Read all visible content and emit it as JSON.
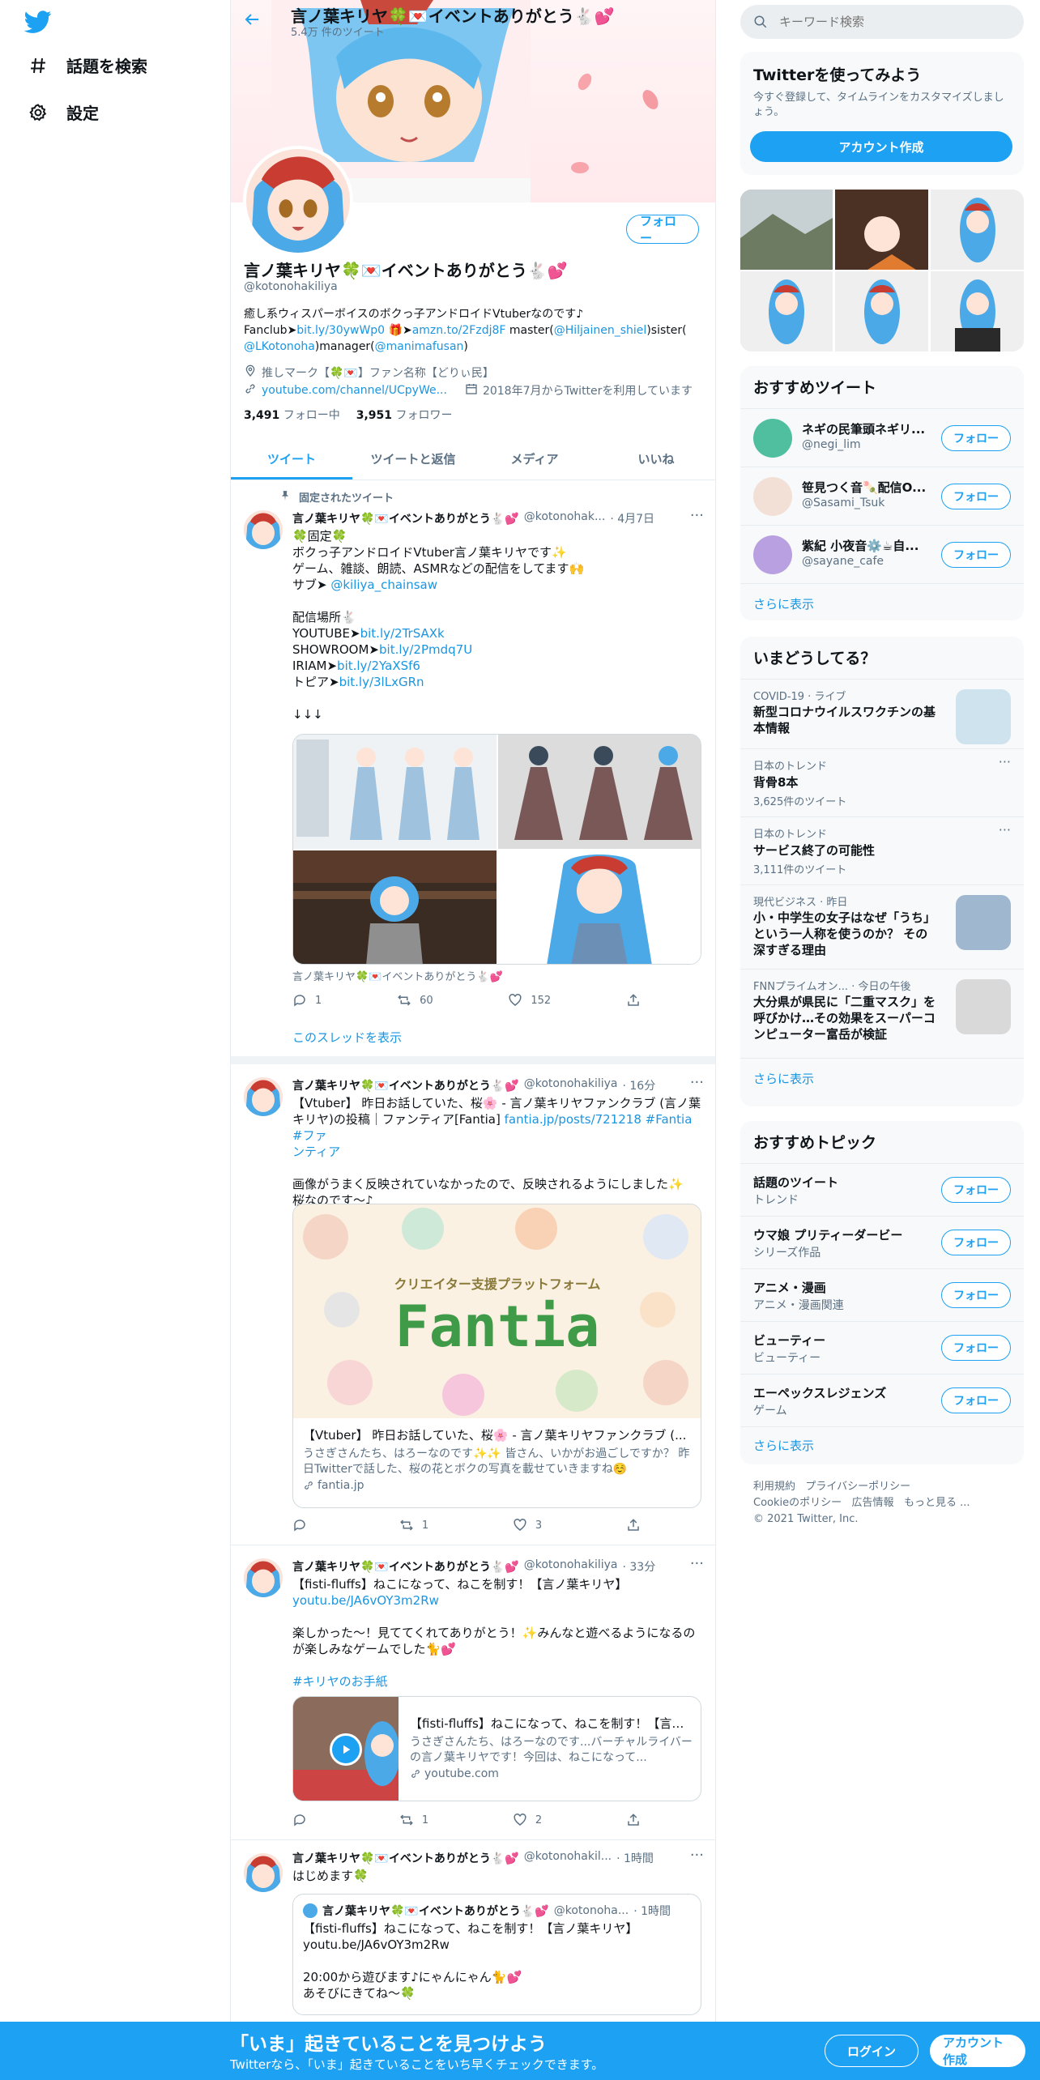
{
  "nav": {
    "explore_label": "話題を検索",
    "settings_label": "設定"
  },
  "header": {
    "title": "言ノ葉キリヤ🍀💌イベントありがとう🐇💕",
    "tweet_count": "5.4万 件のツイート"
  },
  "profile": {
    "name": "言ノ葉キリヤ🍀💌イベントありがとう🐇💕",
    "handle": "@kotonohakiliya",
    "follow_label": "フォロー",
    "bio_line1": "癒し系ウィスパーボイスのボクっ子アンドロイドVtuberなのです♪",
    "bio_line2_a": "Fanclub➤",
    "bio_line2_b": "bit.ly/30ywWp0",
    "bio_line2_c": " 🎁➤",
    "bio_line2_d": "amzn.to/2Fzdj8F",
    "bio_line2_e": " master(",
    "bio_line2_f": "@Hiljainen_shiel",
    "bio_line2_g": ")sister(",
    "bio_line3_a": "@LKotonoha",
    "bio_line3_b": ")manager(",
    "bio_line3_c": "@manimafusan",
    "bio_line3_d": ")",
    "location": "推しマーク【🍀💌】ファン名称【どりぃ民】",
    "url": "youtube.com/channel/UCpyWe...",
    "joined": "2018年7月からTwitterを利用しています",
    "following_count": "3,491",
    "following_label": "フォロー中",
    "followers_count": "3,951",
    "followers_label": "フォロワー"
  },
  "tabs": [
    "ツイート",
    "ツイートと返信",
    "メディア",
    "いいね"
  ],
  "tweets": [
    {
      "pinned_label": "固定されたツイート",
      "name": "言ノ葉キリヤ🍀💌イベントありがとう🐇💕",
      "handle": "@kotonohak...",
      "time": "· 4月7日",
      "lines": [
        "🍀固定🍀",
        "ボクっ子アンドロイドVtuber言ノ葉キリヤです✨",
        "ゲーム、雑談、朗読、ASMRなどの配信をしてます🙌"
      ],
      "sub_prefix": "サブ➤ ",
      "sub_link": "@kiliya_chainsaw",
      "place_header": "配信場所🐇",
      "yt_prefix": "YOUTUBE➤",
      "yt_link": "bit.ly/2TrSAXk",
      "sr_prefix": "SHOWROOM➤",
      "sr_link": "bit.ly/2Pmdq7U",
      "iriam_prefix": "IRIAM➤",
      "iriam_link": "bit.ly/2YaXSf6",
      "topia_prefix": "トピア➤",
      "topia_link": "bit.ly/3lLxGRn",
      "arrows": "↓↓↓",
      "media_caption": "言ノ葉キリヤ🍀💌イベントありがとう🐇💕",
      "reply_count": "1",
      "retweet_count": "60",
      "like_count": "152",
      "thread_link": "このスレッドを表示"
    },
    {
      "name": "言ノ葉キリヤ🍀💌イベントありがとう🐇💕",
      "handle": "@kotonohakiliya",
      "time": "· 16分",
      "line1": "【Vtuber】 昨日お話していた、桜🌸 - 言ノ葉キリヤファンクラブ (言ノ葉",
      "line2_a": "キリヤ)の投稿｜ファンティア[Fantia] ",
      "line2_b": "fantia.jp/posts/721218",
      "line2_c": " #Fantia",
      "line2_d": " #ファ",
      "line3": "ンティア",
      "line4": "画像がうまく反映されていなかったので、反映されるようにしました✨",
      "line5": "桜なのです～♪",
      "card_image_heading": "クリエイター支援プラットフォーム",
      "card_image_logo": "Fantia",
      "card_title": "【Vtuber】 昨日お話していた、桜🌸 - 言ノ葉キリヤファンクラブ (...",
      "card_desc": "うさぎさんたち、はろーなのです✨✨ 皆さん、いかがお過ごしですか？ 昨日Twitterで話した、桜の花とボクの写真を載せていきますね☺️",
      "card_domain": "fantia.jp",
      "reply_count": "",
      "retweet_count": "1",
      "like_count": "3"
    },
    {
      "name": "言ノ葉キリヤ🍀💌イベントありがとう🐇💕",
      "handle": "@kotonohakiliya",
      "time": "· 33分",
      "line1": "【fisti-fluffs】ねこになって、ねこを制す！【言ノ葉キリヤ】",
      "line2": "youtu.be/JA6vOY3m2Rw",
      "line3": "楽しかった～！見ててくれてありがとう！✨みんなと遊べるようになるの",
      "line4": "が楽しみなゲームでした🐈💕",
      "hashtag": "#キリヤのお手紙",
      "card_title": "【fisti-fluffs】ねこになって、ねこを制す！【言ノ...",
      "card_desc": "うさぎさんたち、はろーなのです...バーチャルライバーの言ノ葉キリヤです！今回は、ねこになって...",
      "card_domain": "youtube.com",
      "reply_count": "",
      "retweet_count": "1",
      "like_count": "2"
    },
    {
      "name": "言ノ葉キリヤ🍀💌イベントありがとう🐇💕",
      "handle": "@kotonohakil...",
      "time": "· 1時間",
      "line1": "はじめます🍀",
      "quote_name": "言ノ葉キリヤ🍀💌イベントありがとう🐇💕",
      "quote_handle": "@kotonoha...",
      "quote_time": "· 1時間",
      "quote_line1": "【fisti-fluffs】ねこになって、ねこを制す！【言ノ葉キリヤ】",
      "quote_line2": "youtu.be/JA6vOY3m2Rw",
      "quote_line3": "20:00から遊びます♪にゃんにゃん🐈💕",
      "quote_line4": "あそびにきてね～🍀"
    }
  ],
  "right": {
    "search_placeholder": "キーワード検索",
    "signup_title": "Twitterを使ってみよう",
    "signup_desc": "今すぐ登録して、タイムラインをカスタマイズしましょう。",
    "signup_button": "アカウント作成",
    "rec_tweets_title": "おすすめツイート",
    "rec_users": [
      {
        "name": "ネギの民筆頭ネギリ...",
        "handle": "@negi_lim",
        "follow": "フォロー"
      },
      {
        "name": "笹見つく音🍡配信O...",
        "handle": "@Sasami_Tsuk",
        "follow": "フォロー"
      },
      {
        "name": "紫紀 小夜音⚙️☕自...",
        "handle": "@sayane_cafe",
        "follow": "フォロー"
      }
    ],
    "show_more": "さらに表示",
    "trends_title": "いまどうしてる？",
    "trends": [
      {
        "meta": "COVID-19 · ライブ",
        "title": "新型コロナウイルスワクチンの基本情報",
        "count": ""
      },
      {
        "meta": "日本のトレンド",
        "title": "背骨8本",
        "count": "3,625件のツイート"
      },
      {
        "meta": "日本のトレンド",
        "title": "サービス終了の可能性",
        "count": "3,111件のツイート"
      },
      {
        "meta": "現代ビジネス · 昨日",
        "title": "小・中学生の女子はなぜ「うち」という一人称を使うのか？ その深すぎる理由",
        "count": ""
      },
      {
        "meta": "FNNプライムオン... · 今日の午後",
        "title": "大分県が県民に「二重マスク」を呼びかけ…その効果をスーパーコンピューター富岳が検証",
        "count": ""
      }
    ],
    "topics_title": "おすすめトピック",
    "topics": [
      {
        "title": "話題のツイート",
        "sub": "トレンド",
        "follow": "フォロー"
      },
      {
        "title": "ウマ娘 プリティーダービー",
        "sub": "シリーズ作品",
        "follow": "フォロー"
      },
      {
        "title": "アニメ・漫画",
        "sub": "アニメ・漫画関連",
        "follow": "フォロー"
      },
      {
        "title": "ビューティー",
        "sub": "ビューティー",
        "follow": "フォロー"
      },
      {
        "title": "エーペックスレジェンズ",
        "sub": "ゲーム",
        "follow": "フォロー"
      }
    ],
    "footer": {
      "terms": "利用規約",
      "privacy": "プライバシーポリシー",
      "cookie": "Cookieのポリシー",
      "ads": "広告情報",
      "more": "もっと見る ...",
      "copyright": "© 2021 Twitter, Inc."
    }
  },
  "bottom_bar": {
    "title": "「いま」起きていることを見つけよう",
    "subtitle": "Twitterなら、「いま」起きていることをいち早くチェックできます。",
    "login": "ログイン",
    "signup": "アカウント作成"
  },
  "colors": {
    "accent": "#1da1f2",
    "link": "#1b95e0",
    "muted": "#5b7083"
  }
}
